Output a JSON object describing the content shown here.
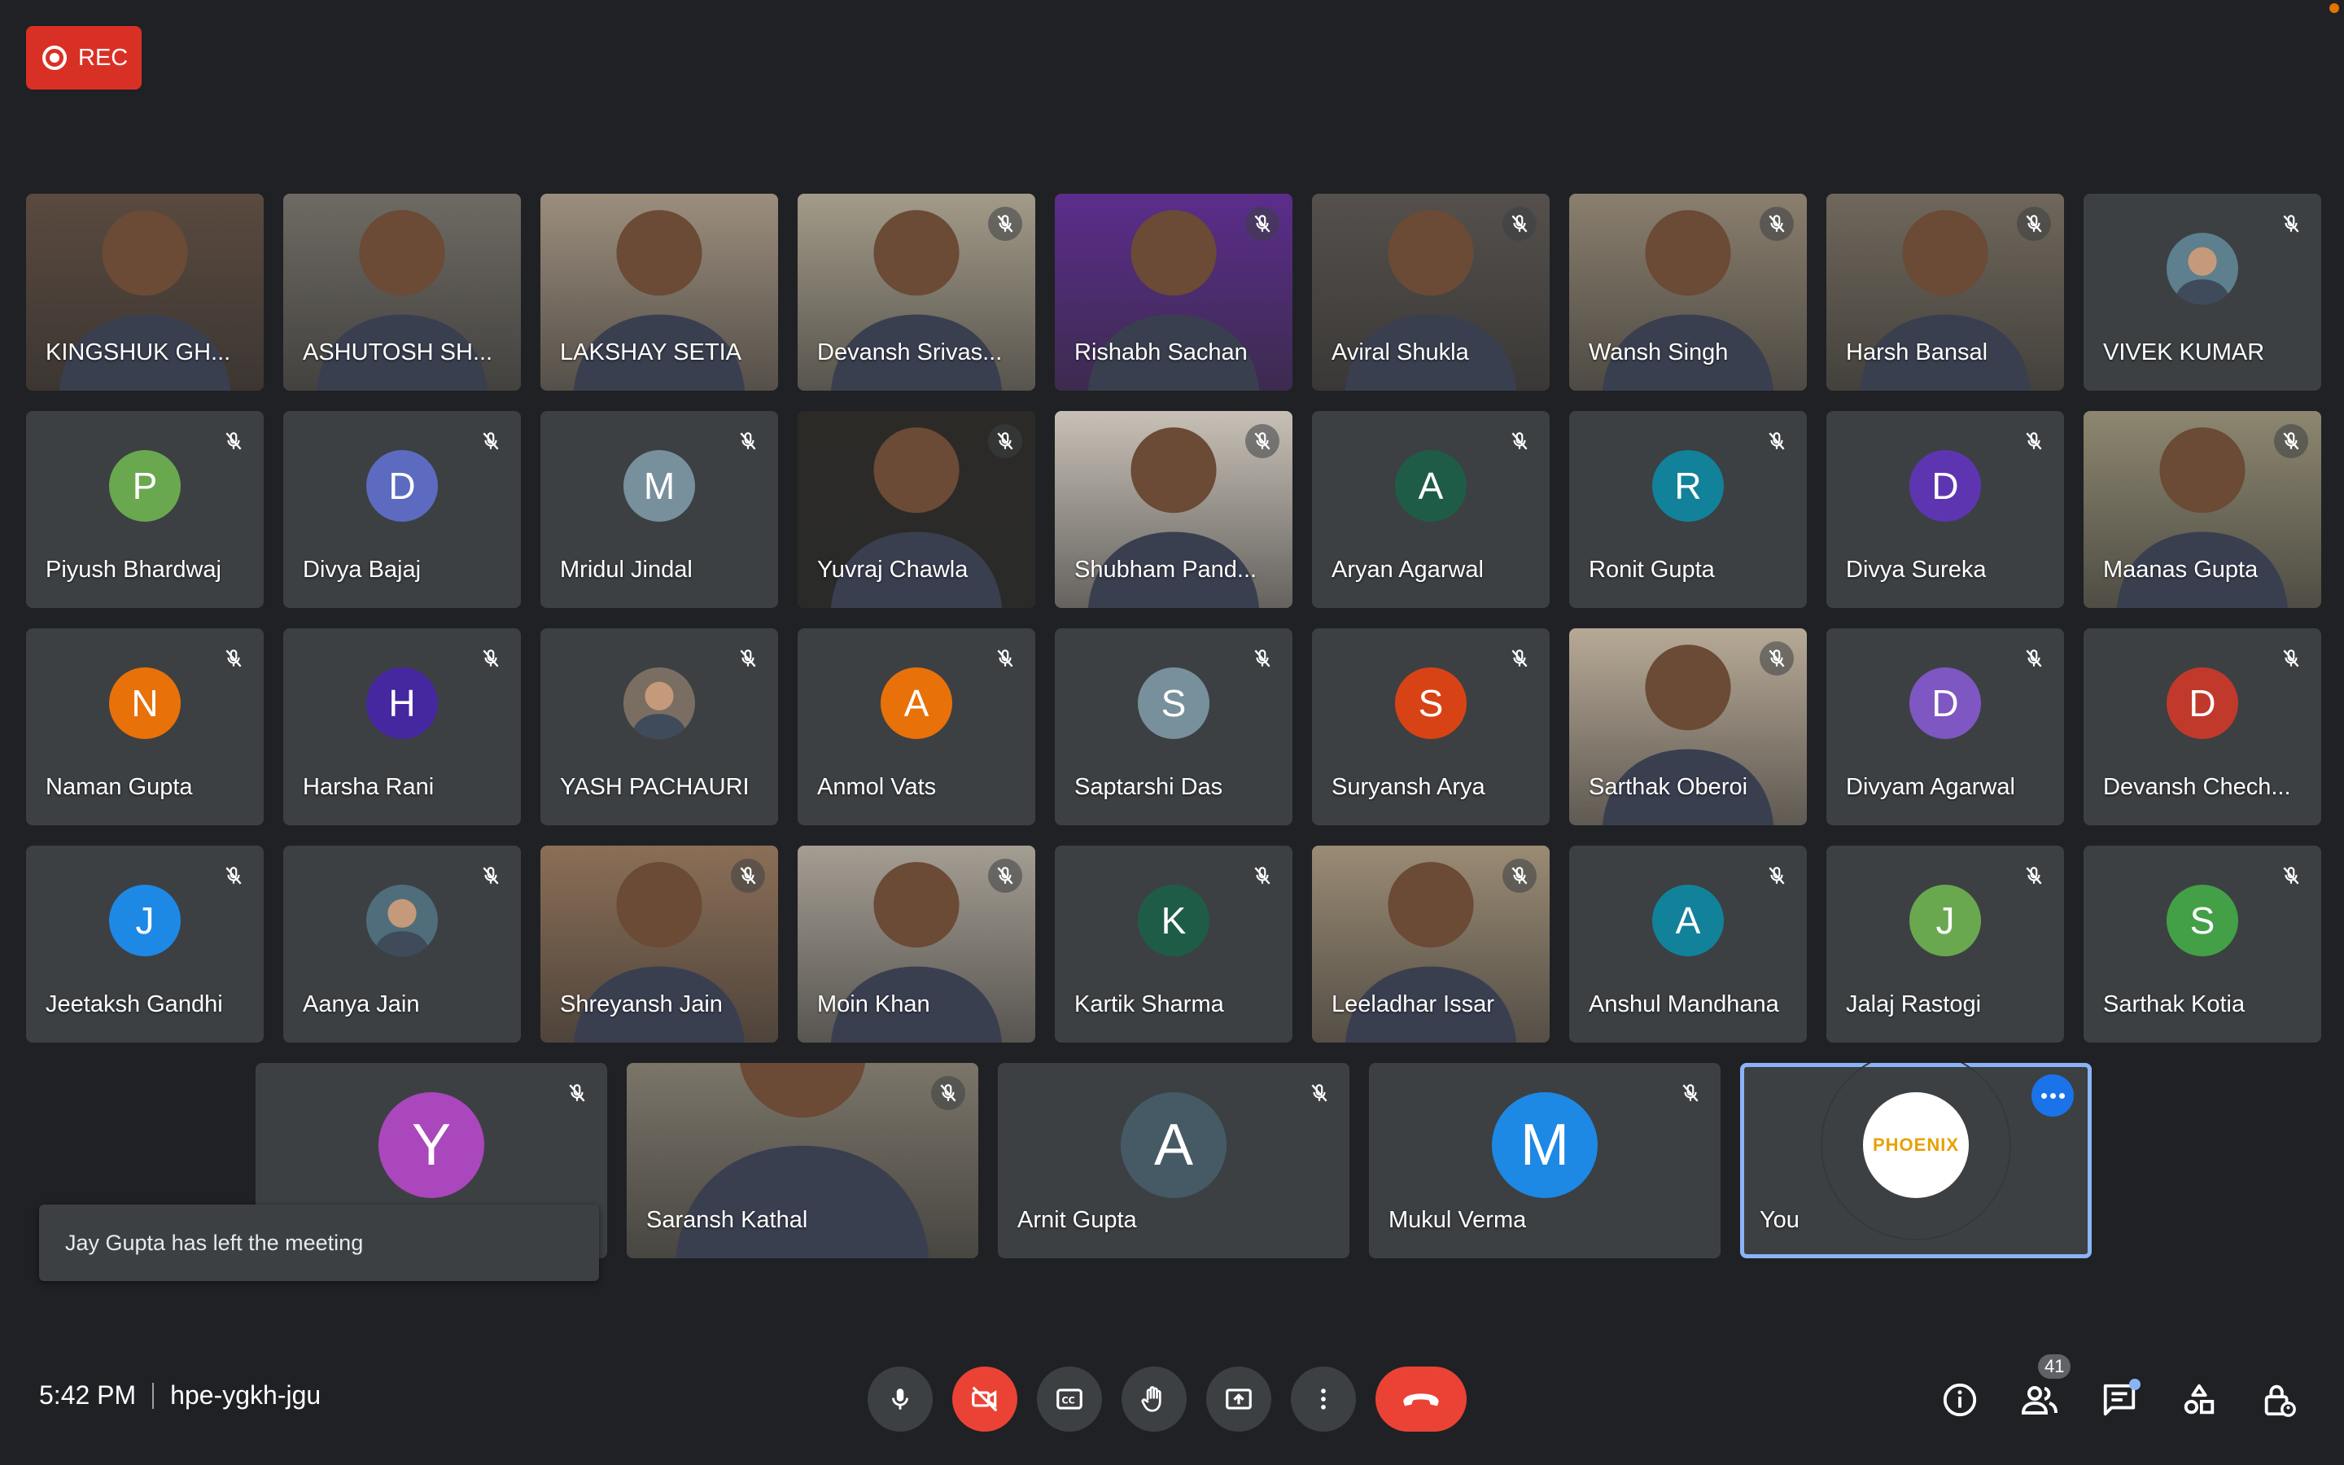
{
  "recording": {
    "label": "REC"
  },
  "tiles": [
    {
      "name": "KINGSHUK GH...",
      "kind": "video",
      "muted": false,
      "bg": "#5a4a3f"
    },
    {
      "name": "ASHUTOSH SH...",
      "kind": "video",
      "muted": false,
      "bg": "#6e6a63"
    },
    {
      "name": "LAKSHAY SETIA",
      "kind": "video",
      "muted": false,
      "bg": "#9c8e7d"
    },
    {
      "name": "Devansh Srivas...",
      "kind": "video",
      "muted": true,
      "bg": "#a39b89"
    },
    {
      "name": "Rishabh Sachan",
      "kind": "video",
      "muted": true,
      "bg": "#5b2d8c"
    },
    {
      "name": "Aviral Shukla",
      "kind": "video",
      "muted": true,
      "bg": "#55504c"
    },
    {
      "name": "Wansh Singh",
      "kind": "video",
      "muted": true,
      "bg": "#8a7f6e"
    },
    {
      "name": "Harsh Bansal",
      "kind": "video",
      "muted": true,
      "bg": "#6f675b"
    },
    {
      "name": "VIVEK KUMAR",
      "kind": "photo",
      "muted": true,
      "letter": "",
      "color": "#5d7f8e"
    },
    {
      "name": "Piyush Bhardwaj",
      "kind": "avatar",
      "muted": true,
      "letter": "P",
      "color": "#6aa84f"
    },
    {
      "name": "Divya Bajaj",
      "kind": "avatar",
      "muted": true,
      "letter": "D",
      "color": "#5c6bc0"
    },
    {
      "name": "Mridul Jindal",
      "kind": "avatar",
      "muted": true,
      "letter": "M",
      "color": "#78909c"
    },
    {
      "name": "Yuvraj Chawla",
      "kind": "video",
      "muted": true,
      "bg": "#2b2a27"
    },
    {
      "name": "Shubham Pand...",
      "kind": "video",
      "muted": true,
      "bg": "#c7c0b6"
    },
    {
      "name": "Aryan Agarwal",
      "kind": "avatar",
      "muted": true,
      "letter": "A",
      "color": "#1f5c47"
    },
    {
      "name": "Ronit Gupta",
      "kind": "avatar",
      "muted": true,
      "letter": "R",
      "color": "#12829a"
    },
    {
      "name": "Divya Sureka",
      "kind": "avatar",
      "muted": true,
      "letter": "D",
      "color": "#5e35b1"
    },
    {
      "name": "Maanas Gupta",
      "kind": "video",
      "muted": true,
      "bg": "#8d8770"
    },
    {
      "name": "Naman Gupta",
      "kind": "avatar",
      "muted": true,
      "letter": "N",
      "color": "#e8710a"
    },
    {
      "name": "Harsha Rani",
      "kind": "avatar",
      "muted": true,
      "letter": "H",
      "color": "#4527a0"
    },
    {
      "name": "YASH PACHAURI",
      "kind": "photo",
      "muted": true,
      "letter": "",
      "color": "#7a6e63"
    },
    {
      "name": "Anmol Vats",
      "kind": "avatar",
      "muted": true,
      "letter": "A",
      "color": "#e8710a"
    },
    {
      "name": "Saptarshi Das",
      "kind": "avatar",
      "muted": true,
      "letter": "S",
      "color": "#78909c"
    },
    {
      "name": "Suryansh Arya",
      "kind": "avatar",
      "muted": true,
      "letter": "S",
      "color": "#d84315"
    },
    {
      "name": "Sarthak Oberoi",
      "kind": "video",
      "muted": true,
      "bg": "#b7a996"
    },
    {
      "name": "Divyam Agarwal",
      "kind": "avatar",
      "muted": true,
      "letter": "D",
      "color": "#7e57c2"
    },
    {
      "name": "Devansh Chech...",
      "kind": "avatar",
      "muted": true,
      "letter": "D",
      "color": "#c0392b"
    },
    {
      "name": "Jeetaksh Gandhi",
      "kind": "avatar",
      "muted": true,
      "letter": "J",
      "color": "#1e88e5"
    },
    {
      "name": "Aanya Jain",
      "kind": "photo",
      "muted": true,
      "letter": "",
      "color": "#4f6d7a"
    },
    {
      "name": "Shreyansh Jain",
      "kind": "video",
      "muted": true,
      "bg": "#8b6f57"
    },
    {
      "name": "Moin Khan",
      "kind": "video",
      "muted": true,
      "bg": "#a49d92"
    },
    {
      "name": "Kartik Sharma",
      "kind": "avatar",
      "muted": true,
      "letter": "K",
      "color": "#1f5c47"
    },
    {
      "name": "Leeladhar Issar",
      "kind": "video",
      "muted": true,
      "bg": "#9a8b74"
    },
    {
      "name": "Anshul Mandhana",
      "kind": "avatar",
      "muted": true,
      "letter": "A",
      "color": "#12829a"
    },
    {
      "name": "Jalaj Rastogi",
      "kind": "avatar",
      "muted": true,
      "letter": "J",
      "color": "#6aa84f"
    },
    {
      "name": "Sarthak Kotia",
      "kind": "avatar",
      "muted": true,
      "letter": "S",
      "color": "#43a047"
    }
  ],
  "row5": [
    {
      "name": "",
      "kind": "avatar",
      "muted": true,
      "letter": "Y",
      "color": "#ab47bc"
    },
    {
      "name": "Saransh Kathal",
      "kind": "video",
      "muted": true,
      "bg": "#7b7569"
    },
    {
      "name": "Arnit Gupta",
      "kind": "avatar",
      "muted": true,
      "letter": "A",
      "color": "#455a64"
    },
    {
      "name": "Mukul Verma",
      "kind": "avatar",
      "muted": true,
      "letter": "M",
      "color": "#1e88e5"
    }
  ],
  "self": {
    "name": "You",
    "logo_text": "PHOENIX"
  },
  "toast": {
    "text": "Jay Gupta has left the meeting"
  },
  "meeting": {
    "time": "5:42 PM",
    "code": "hpe-ygkh-jgu"
  },
  "controls": [
    "mic-icon",
    "camera-off-icon",
    "captions-icon",
    "raise-hand-icon",
    "present-icon",
    "more-options-icon",
    "end-call-icon"
  ],
  "right": {
    "participants_count": "41"
  }
}
